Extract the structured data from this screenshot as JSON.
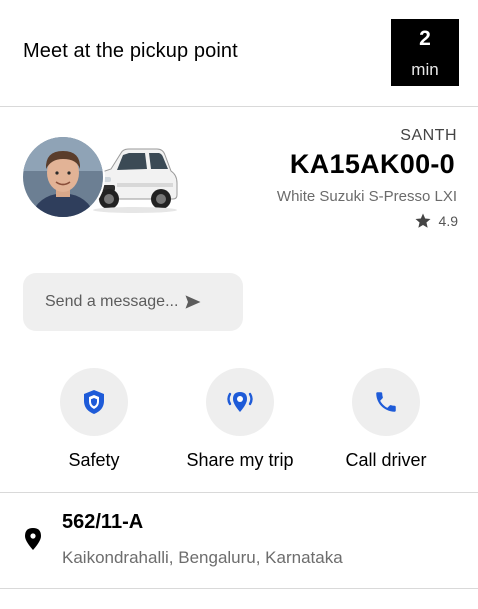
{
  "header": {
    "title": "Meet at the pickup point",
    "eta_value": "2",
    "eta_unit": "min"
  },
  "driver": {
    "name": "SANTH",
    "plate": "KA15AK00-0",
    "car_model": "White Suzuki S-Presso LXI",
    "rating": "4.9",
    "avatar_icon": "driver-photo",
    "car_icon": "car-photo"
  },
  "message": {
    "placeholder": "Send a message...",
    "icon": "send-arrow-icon"
  },
  "actions": [
    {
      "label": "Safety",
      "icon": "shield-icon",
      "color": "#1e5bd8"
    },
    {
      "label": "Share my trip",
      "icon": "share-location-icon",
      "color": "#1e5bd8"
    },
    {
      "label": "Call driver",
      "icon": "phone-icon",
      "color": "#1e5bd8"
    }
  ],
  "destination": {
    "title": "562/11-A",
    "subtitle": "Kaikondrahalli, Bengaluru, Karnataka",
    "icon": "location-pin-icon"
  },
  "colors": {
    "accent": "#1e5bd8",
    "eta_bg": "#000000",
    "button_bg": "#eeeeee"
  }
}
